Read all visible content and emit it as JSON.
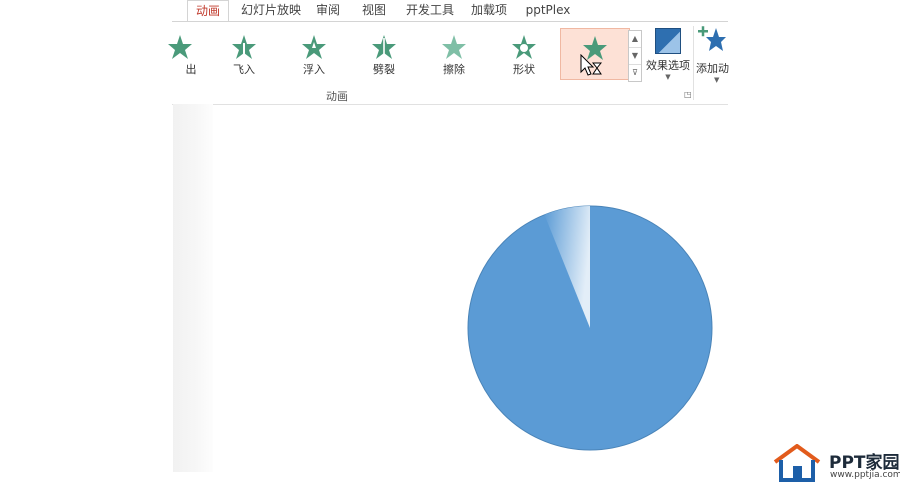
{
  "tabs": [
    {
      "label": "动画",
      "active": true
    },
    {
      "label": "幻灯片放映",
      "active": false
    },
    {
      "label": "审阅",
      "active": false
    },
    {
      "label": "视图",
      "active": false
    },
    {
      "label": "开发工具",
      "active": false
    },
    {
      "label": "加载项",
      "active": false
    },
    {
      "label": "pptPlex",
      "active": false
    }
  ],
  "animations": [
    {
      "label": "出",
      "selected": false
    },
    {
      "label": "飞入",
      "selected": false
    },
    {
      "label": "浮入",
      "selected": false
    },
    {
      "label": "劈裂",
      "selected": false
    },
    {
      "label": "擦除",
      "selected": false
    },
    {
      "label": "形状",
      "selected": false
    },
    {
      "label": "",
      "selected": true
    }
  ],
  "ribbon": {
    "group_label": "动画",
    "effect_options": "效果选项",
    "add_animation": "添加动",
    "launcher_icon": "dialog-launcher-icon"
  },
  "pie": {
    "primary_color": "#5b9bd5",
    "highlight_color": "#a8c9e8",
    "wedge_fraction": 0.08
  },
  "logo": {
    "text": "PPT家园",
    "sub": "www.pptjia.com"
  },
  "colors": {
    "accent": "#c0392b",
    "selected_bg": "#fde1d6",
    "star_green": "#4a9a7a"
  }
}
